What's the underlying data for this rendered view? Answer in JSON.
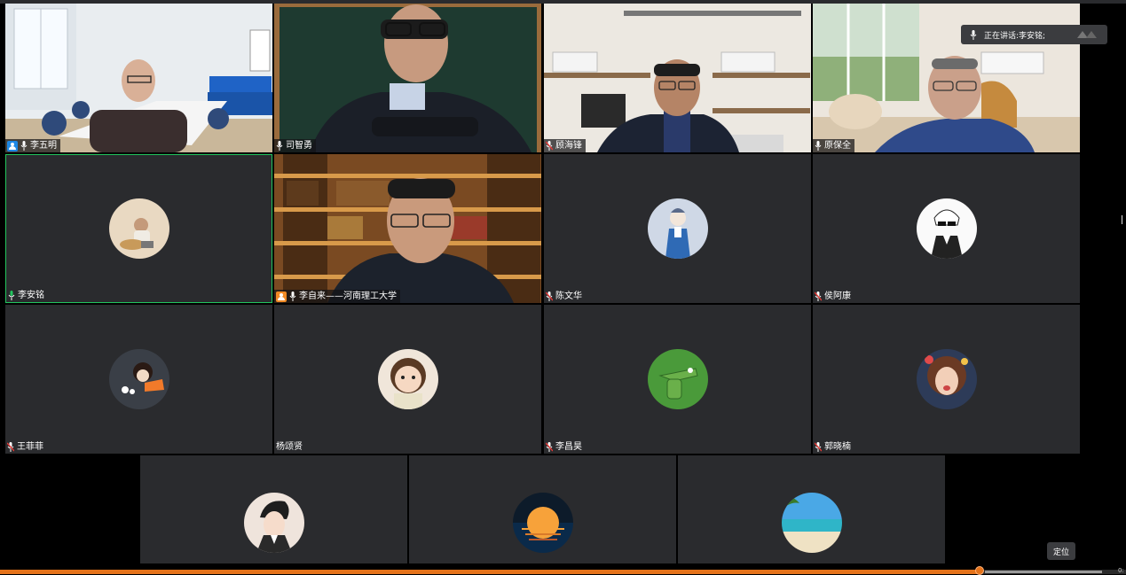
{
  "speaking": {
    "prefix": "正在讲话: ",
    "name": "李安铭;"
  },
  "locate_label": "定位",
  "progress": {
    "value_fraction": 0.87,
    "time_fragment": "0:"
  },
  "participants": [
    {
      "name": "李五明",
      "host": true,
      "video": true
    },
    {
      "name": "司智勇",
      "video": true
    },
    {
      "name": "顾海锋",
      "video": true,
      "muted": true
    },
    {
      "name": "原保全",
      "video": true
    },
    {
      "name": "李安铭",
      "active_speaker": true
    },
    {
      "name": "李自来——河南理工大学",
      "host": true,
      "video": true
    },
    {
      "name": "陈文华",
      "muted": true
    },
    {
      "name": "侯阿康",
      "muted": true
    },
    {
      "name": "王菲菲",
      "muted": true
    },
    {
      "name": "杨颂贤"
    },
    {
      "name": "李昌昊",
      "muted": true
    },
    {
      "name": "郭晓楠",
      "muted": true
    },
    {
      "name": ""
    },
    {
      "name": ""
    },
    {
      "name": ""
    }
  ],
  "colors": {
    "tile_bg": "#2a2b2e",
    "active_border": "#22c55e",
    "host_badge": "#1e88e5",
    "progress": "#e5731a"
  }
}
